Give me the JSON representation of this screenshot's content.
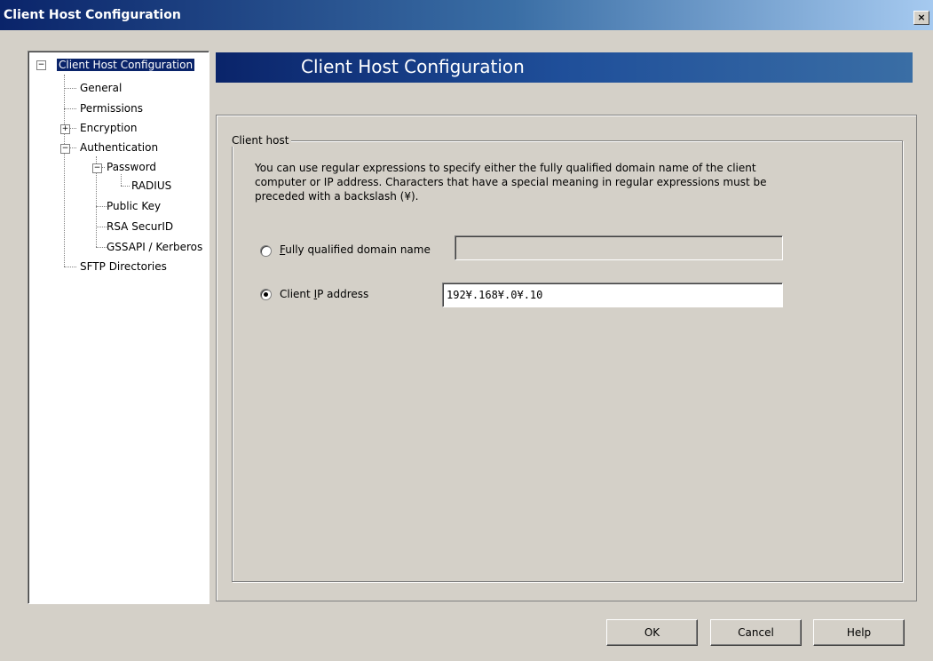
{
  "window": {
    "title": "Client Host Configuration",
    "close_label": "×"
  },
  "tree": {
    "root": "Client Host Configuration",
    "general": "General",
    "permissions": "Permissions",
    "encryption": "Encryption",
    "authentication": "Authentication",
    "password": "Password",
    "radius": "RADIUS",
    "public_key": "Public Key",
    "rsa_securid": "RSA SecurID",
    "gssapi": "GSSAPI / Kerberos",
    "sftp_directories": "SFTP Directories"
  },
  "header": {
    "title": "Client Host Configuration"
  },
  "group": {
    "legend": "Client host",
    "description": "You can use regular expressions to specify either the fully qualified domain name of the client computer or IP address.  Characters that have a special meaning in regular expressions must be preceded with a backslash (¥)."
  },
  "options": {
    "fqdn": {
      "label_rest": "ully qualified domain name",
      "accel": "F",
      "value": "",
      "selected": false
    },
    "ip": {
      "label_pre": "Client ",
      "accel": "I",
      "label_rest": "P address",
      "value": "192¥.168¥.0¥.10",
      "selected": true
    }
  },
  "buttons": {
    "ok": "OK",
    "cancel": "Cancel",
    "help": "Help"
  }
}
